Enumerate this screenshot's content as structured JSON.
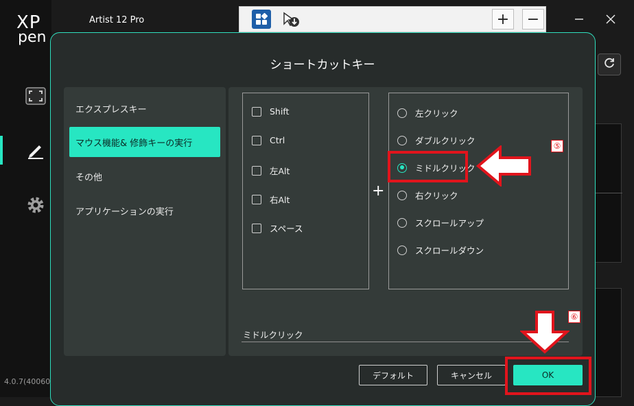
{
  "app": {
    "logo_top": "XP",
    "logo_bottom": "pen",
    "device_name": "Artist 12 Pro",
    "version": "4.0.7(40060",
    "window_controls": [
      "minimize-icon",
      "close-icon"
    ],
    "rail_icons": [
      "display-area-icon",
      "pen-icon",
      "gear-icon"
    ],
    "toolbar": {
      "zoom_in": "+",
      "zoom_out": "−"
    }
  },
  "dialog": {
    "title": "ショートカットキー",
    "sidebar_items": [
      {
        "label": "エクスプレスキー",
        "active": false
      },
      {
        "label": "マウス機能& 修飾キーの実行",
        "active": true
      },
      {
        "label": "その他",
        "active": false
      },
      {
        "label": "アプリケーションの実行",
        "active": false
      }
    ],
    "modifiers": [
      {
        "label": "Shift",
        "checked": false
      },
      {
        "label": "Ctrl",
        "checked": false
      },
      {
        "label": "左Alt",
        "checked": false
      },
      {
        "label": "右Alt",
        "checked": false
      },
      {
        "label": "スペース",
        "checked": false
      }
    ],
    "plus_sign": "+",
    "mouse_actions": [
      {
        "label": "左クリック",
        "selected": false
      },
      {
        "label": "ダブルクリック",
        "selected": false
      },
      {
        "label": "ミドルクリック",
        "selected": true
      },
      {
        "label": "右クリック",
        "selected": false
      },
      {
        "label": "スクロールアップ",
        "selected": false
      },
      {
        "label": "スクロールダウン",
        "selected": false
      }
    ],
    "result_value": "ミドルクリック",
    "buttons": {
      "default": "デフォルト",
      "cancel": "キャンセル",
      "ok": "OK"
    }
  },
  "annotations": {
    "step5": "⑤",
    "step6": "⑥",
    "color": "#e1141c"
  },
  "colors": {
    "accent": "#27e6c2",
    "panel": "#343b39",
    "dialog_bg": "#272c2b"
  }
}
